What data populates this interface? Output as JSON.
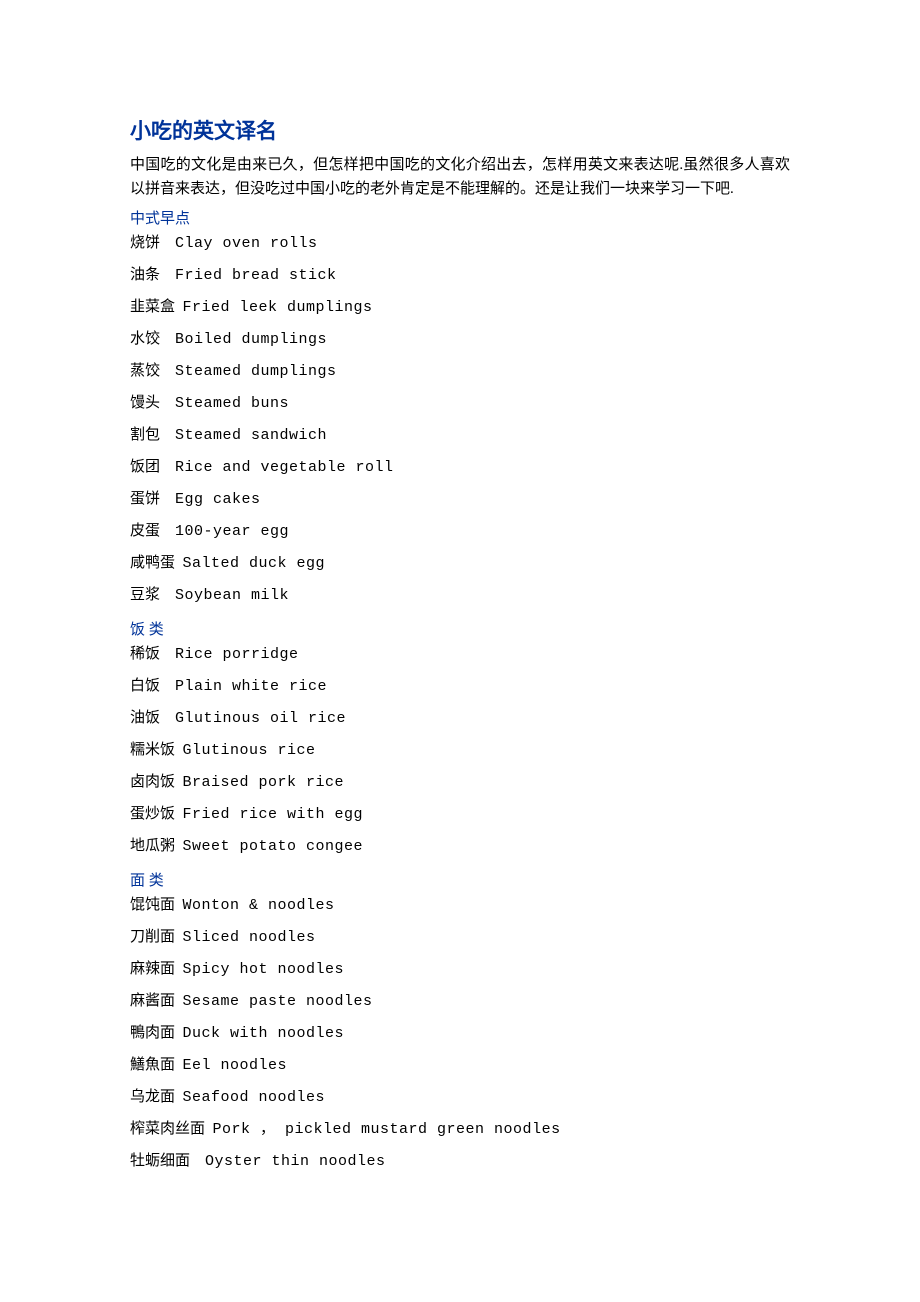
{
  "title": "小吃的英文译名",
  "intro": "中国吃的文化是由来已久，但怎样把中国吃的文化介绍出去，怎样用英文来表达呢.虽然很多人喜欢以拼音来表达，但没吃过中国小吃的老外肯定是不能理解的。还是让我们一块来学习一下吧.",
  "sections": [
    {
      "heading": "中式早点",
      "items": [
        {
          "zh": "烧饼",
          "sep": "1",
          "en": "Clay oven rolls"
        },
        {
          "zh": "油条",
          "sep": "1",
          "en": "Fried bread stick"
        },
        {
          "zh": "韭菜盒",
          "sep": "2",
          "en": "Fried leek dumplings"
        },
        {
          "zh": "水饺",
          "sep": "1",
          "en": "Boiled dumplings"
        },
        {
          "zh": "蒸饺",
          "sep": "1",
          "en": "Steamed dumplings"
        },
        {
          "zh": "馒头",
          "sep": "1",
          "en": "Steamed buns"
        },
        {
          "zh": "割包",
          "sep": "1",
          "en": "Steamed sandwich"
        },
        {
          "zh": "饭团",
          "sep": "1",
          "en": "Rice and vegetable roll"
        },
        {
          "zh": "蛋饼",
          "sep": "1",
          "en": "Egg cakes"
        },
        {
          "zh": "皮蛋",
          "sep": "1",
          "en": "100-year egg"
        },
        {
          "zh": "咸鸭蛋",
          "sep": "2",
          "en": "Salted duck egg"
        },
        {
          "zh": "豆浆",
          "sep": "1",
          "en": "Soybean milk"
        }
      ]
    },
    {
      "heading": "饭 类",
      "items": [
        {
          "zh": "稀饭",
          "sep": "1",
          "en": "Rice porridge"
        },
        {
          "zh": "白饭",
          "sep": "1",
          "en": "Plain white rice"
        },
        {
          "zh": "油饭",
          "sep": "1",
          "en": "Glutinous oil rice"
        },
        {
          "zh": "糯米饭",
          "sep": "2",
          "en": "Glutinous rice"
        },
        {
          "zh": "卤肉饭",
          "sep": "2",
          "en": "Braised pork rice"
        },
        {
          "zh": "蛋炒饭",
          "sep": "2",
          "en": "Fried rice with egg"
        },
        {
          "zh": "地瓜粥",
          "sep": "2",
          "en": "Sweet potato congee"
        }
      ]
    },
    {
      "heading": "面 类",
      "items": [
        {
          "zh": "馄饨面",
          "sep": "2",
          "en": "Wonton & noodles"
        },
        {
          "zh": "刀削面",
          "sep": "2",
          "en": "Sliced noodles"
        },
        {
          "zh": "麻辣面",
          "sep": "2",
          "en": "Spicy hot noodles"
        },
        {
          "zh": "麻酱面",
          "sep": "2",
          "en": "Sesame paste noodles"
        },
        {
          "zh": "鴨肉面",
          "sep": "2",
          "en": "Duck with noodles"
        },
        {
          "zh": "鱔魚面",
          "sep": "2",
          "en": "Eel noodles"
        },
        {
          "zh": "乌龙面",
          "sep": "2",
          "en": "Seafood noodles"
        },
        {
          "zh": "榨菜肉丝面",
          "sep": "2",
          "en": "Pork ， pickled mustard green noodles"
        },
        {
          "zh": "牡蛎细面",
          "sep": "1",
          "en": "Oyster thin noodles"
        }
      ]
    }
  ]
}
